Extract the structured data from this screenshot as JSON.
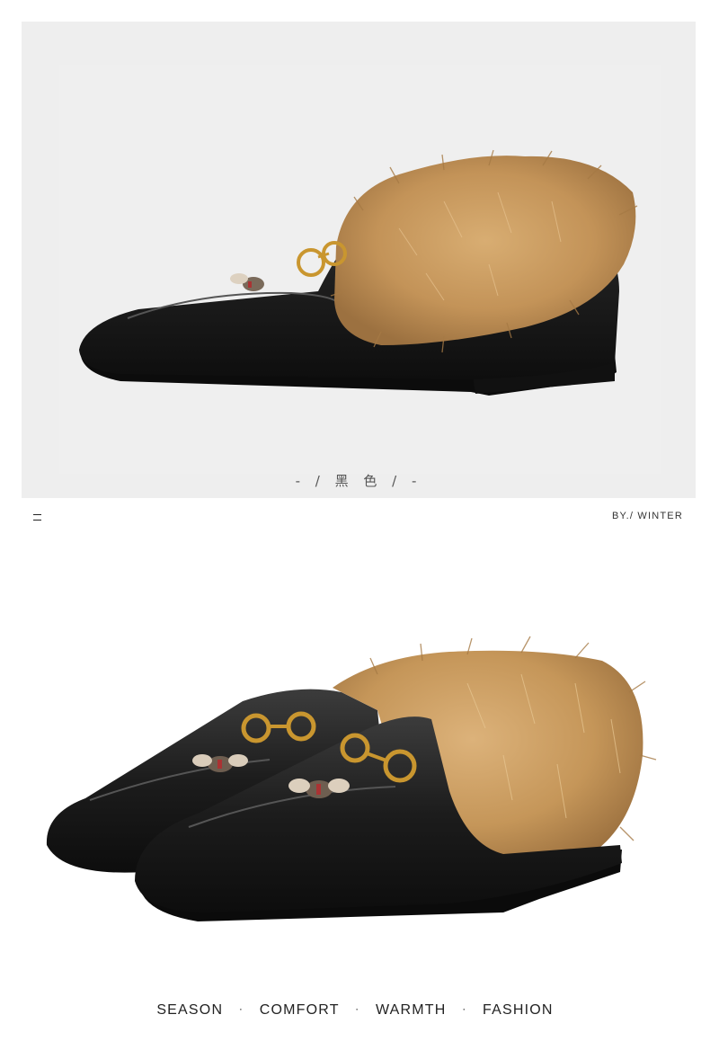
{
  "top_panel": {
    "color_caption": "- / 黑 色 / -",
    "product_image": "black-loafer-side-view-with-fur-collar"
  },
  "divider_row": {
    "left_mark_icon": "double-dash-icon",
    "by_label": "BY./ WINTER"
  },
  "bottom_panel": {
    "product_image": "black-loafer-pair-with-fur-collar"
  },
  "tagline": {
    "items": [
      "SEASON",
      "COMFORT",
      "WARMTH",
      "FASHION"
    ],
    "separator": "·"
  },
  "colors": {
    "panel_bg": "#eeeeee",
    "leather": "#1c1c1c",
    "fur": "#c89a5e",
    "hardware": "#c9962f"
  }
}
